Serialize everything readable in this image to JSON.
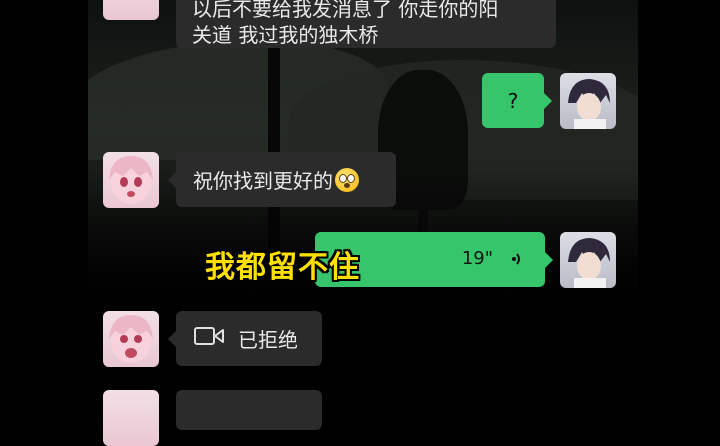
{
  "messages": [
    {
      "side": "received",
      "text_line1": "以后不要给我发消息了 你走你的阳",
      "text_line2": "关道 我过我的独木桥"
    },
    {
      "side": "sent",
      "text": "?"
    },
    {
      "side": "received",
      "text": "祝你找到更好的",
      "emoji": "flushed-face-emoji"
    },
    {
      "side": "sent",
      "type": "voice",
      "duration": "19\""
    },
    {
      "side": "received",
      "type": "video-call",
      "text": "已拒绝"
    }
  ],
  "overlay_caption": "我都留不住",
  "colors": {
    "sent_bubble": "#36c56a",
    "received_bubble": "#2b2b2b",
    "caption": "#ffe000"
  }
}
